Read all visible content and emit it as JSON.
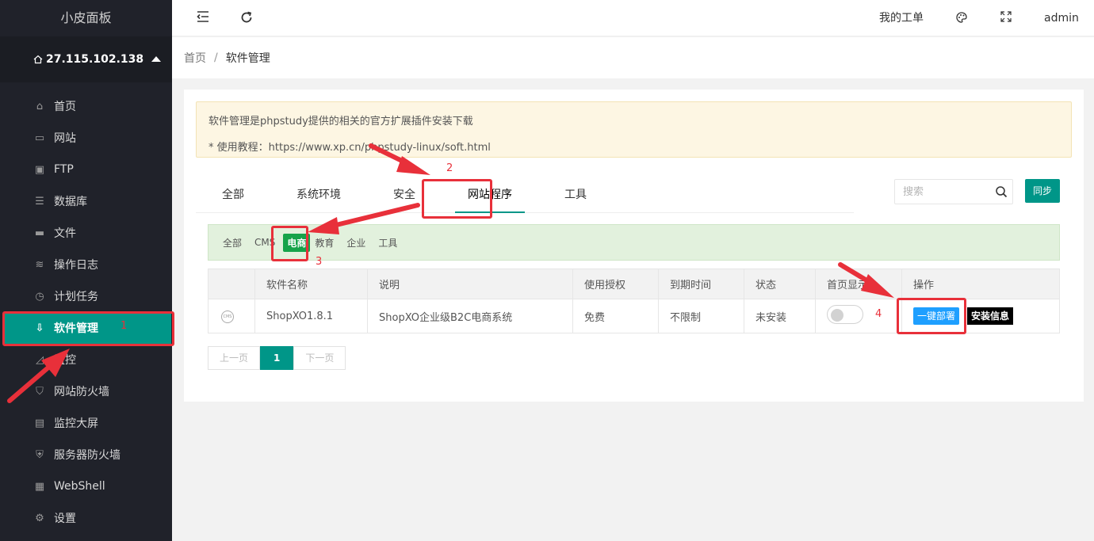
{
  "sidebar": {
    "logo": "小皮面板",
    "server_ip": "27.115.102.138",
    "items": [
      {
        "label": "首页",
        "icon": "home-icon"
      },
      {
        "label": "网站",
        "icon": "monitor-icon"
      },
      {
        "label": "FTP",
        "icon": "ftp-icon"
      },
      {
        "label": "数据库",
        "icon": "database-icon"
      },
      {
        "label": "文件",
        "icon": "folder-icon"
      },
      {
        "label": "操作日志",
        "icon": "layers-icon"
      },
      {
        "label": "计划任务",
        "icon": "clock-icon"
      },
      {
        "label": "软件管理",
        "icon": "download-icon",
        "active": true
      },
      {
        "label": "监控",
        "icon": "chart-icon"
      },
      {
        "label": "网站防火墙",
        "icon": "shield-icon"
      },
      {
        "label": "监控大屏",
        "icon": "screen-icon"
      },
      {
        "label": "服务器防火墙",
        "icon": "shield-check-icon"
      },
      {
        "label": "WebShell",
        "icon": "terminal-icon"
      },
      {
        "label": "设置",
        "icon": "gear-icon"
      }
    ]
  },
  "header": {
    "my_tickets": "我的工单",
    "user": "admin"
  },
  "breadcrumb": {
    "home": "首页",
    "separator": "/",
    "current": "软件管理"
  },
  "notice": {
    "line1": "软件管理是phpstudy提供的相关的官方扩展插件安装下载",
    "line2": "* 使用教程：https://www.xp.cn/phpstudy-linux/soft.html"
  },
  "tabs": [
    {
      "label": "全部"
    },
    {
      "label": "系统环境"
    },
    {
      "label": "安全"
    },
    {
      "label": "网站程序",
      "active": true
    },
    {
      "label": "工具"
    }
  ],
  "search": {
    "placeholder": "搜索"
  },
  "sync_button": "同步",
  "subfilters": [
    {
      "label": "全部"
    },
    {
      "label": "CMS"
    },
    {
      "label": "电商",
      "active": true
    },
    {
      "label": "教育"
    },
    {
      "label": "企业"
    },
    {
      "label": "工具"
    }
  ],
  "table": {
    "headers": [
      "",
      "软件名称",
      "说明",
      "使用授权",
      "到期时间",
      "状态",
      "首页显示",
      "操作"
    ],
    "rows": [
      {
        "icon": "CMS",
        "name": "ShopXO1.8.1",
        "desc": "ShopXO企业级B2C电商系统",
        "license": "免费",
        "expire": "不限制",
        "status": "未安装",
        "homepage_show": false,
        "deploy_button": "一键部署",
        "info_button": "安装信息"
      }
    ]
  },
  "pagination": {
    "prev": "上一页",
    "current": "1",
    "next": "下一页"
  },
  "annotations": {
    "n1": "1",
    "n2": "2",
    "n3": "3",
    "n4": "4",
    "color": "#e8303a"
  },
  "colors": {
    "accent": "#009688",
    "sidebar_bg": "#20222a",
    "deploy_blue": "#1e9fff",
    "ecommerce_green": "#16a34a"
  }
}
